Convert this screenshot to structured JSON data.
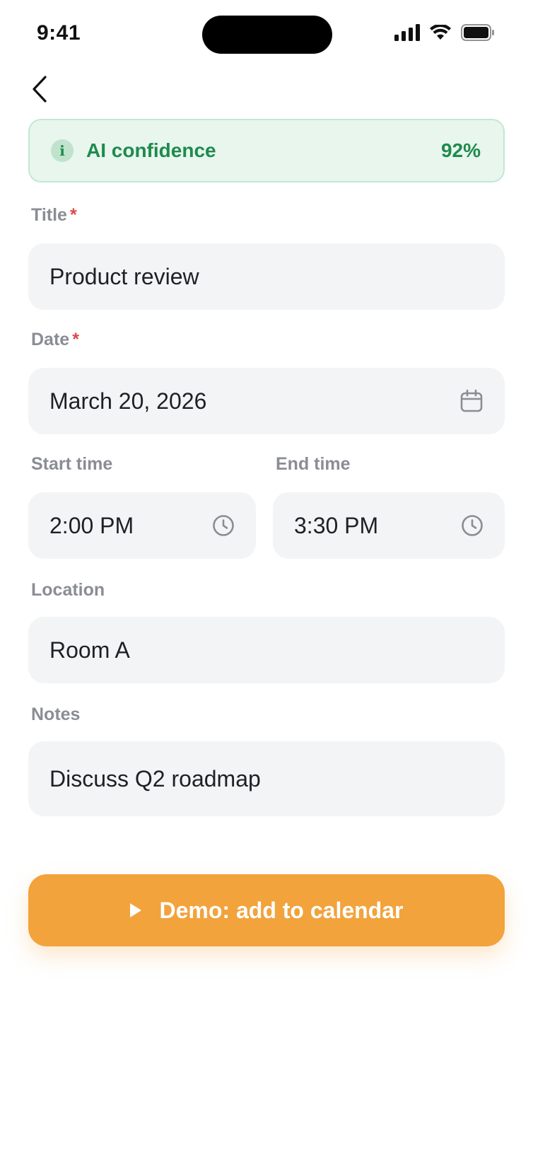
{
  "status_bar": {
    "time": "9:41"
  },
  "confidence": {
    "label": "AI confidence",
    "value": "92%",
    "info_glyph": "i",
    "color": "#1f8b4c"
  },
  "form": {
    "title": {
      "label": "Title",
      "required_mark": "*",
      "value": "Product review"
    },
    "date": {
      "label": "Date",
      "required_mark": "*",
      "value": "March 20, 2026",
      "icon": "calendar-icon"
    },
    "start_time": {
      "label": "Start time",
      "value": "2:00 PM",
      "icon": "clock-icon"
    },
    "end_time": {
      "label": "End time",
      "value": "3:30 PM",
      "icon": "clock-icon"
    },
    "location": {
      "label": "Location",
      "value": "Room A"
    },
    "notes": {
      "label": "Notes",
      "value": "Discuss Q2 roadmap"
    }
  },
  "cta": {
    "label": "Demo: add to calendar",
    "icon": "play-icon",
    "color": "#f2a33c"
  }
}
